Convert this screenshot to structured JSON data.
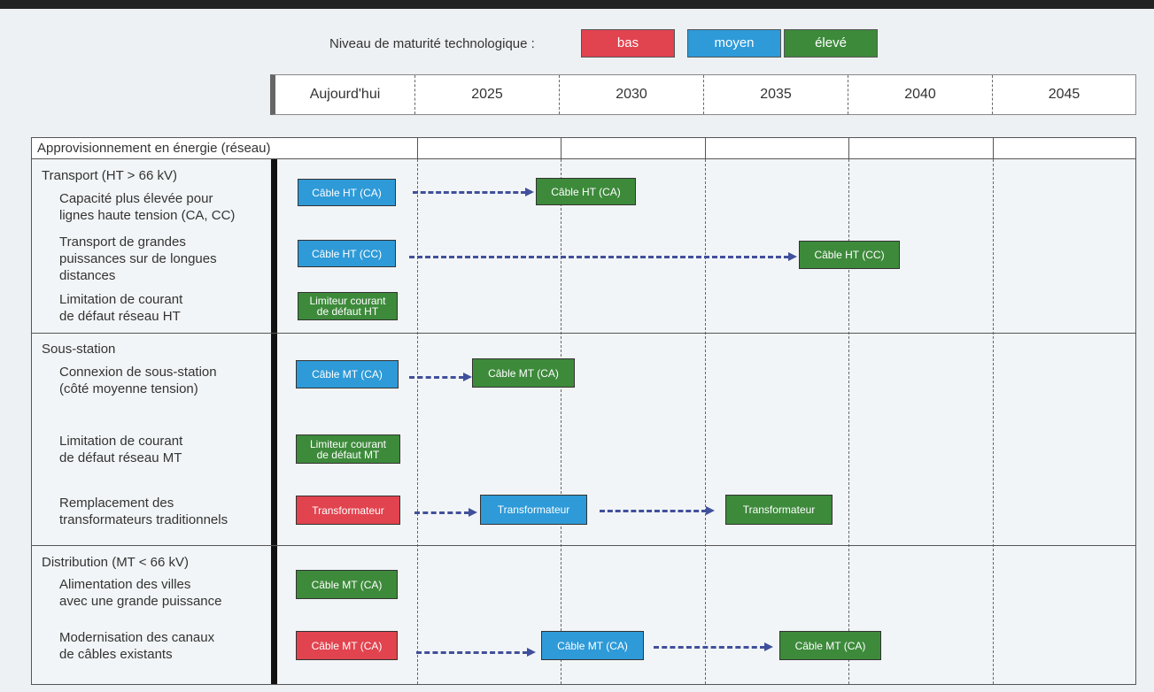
{
  "colors": {
    "low": "#e1434f",
    "medium": "#2e9ad8",
    "high": "#3d8a3b",
    "arrow": "#41509b"
  },
  "legend": {
    "title": "Niveau de maturité technologique :",
    "levels": [
      "bas",
      "moyen",
      "élevé"
    ]
  },
  "timeline": [
    "Aujourd'hui",
    "2025",
    "2030",
    "2035",
    "2040",
    "2045"
  ],
  "grid_title": "Approvisionnement en énergie (réseau)",
  "sections": [
    {
      "title": "Transport (HT > 66 kV)",
      "rows": [
        {
          "label": "Capacité plus élevée pour\nlignes haute tension (CA, CC)",
          "items": [
            {
              "text": "Câble HT (CA)",
              "level": "medium",
              "period": "Aujourd'hui"
            },
            {
              "text": "Câble HT (CA)",
              "level": "high",
              "period": "2030"
            }
          ]
        },
        {
          "label": "Transport de grandes\npuissances sur de longues\ndistances",
          "items": [
            {
              "text": "Câble HT (CC)",
              "level": "medium",
              "period": "Aujourd'hui"
            },
            {
              "text": "Câble HT (CC)",
              "level": "high",
              "period": "2040"
            }
          ]
        },
        {
          "label": "Limitation de courant\nde défaut réseau HT",
          "items": [
            {
              "text": "Limiteur courant\nde défaut HT",
              "level": "high",
              "period": "Aujourd'hui"
            }
          ]
        }
      ]
    },
    {
      "title": "Sous-station",
      "rows": [
        {
          "label": "Connexion de sous-station\n(côté moyenne tension)",
          "items": [
            {
              "text": "Câble MT (CA)",
              "level": "medium",
              "period": "Aujourd'hui"
            },
            {
              "text": "Câble MT (CA)",
              "level": "high",
              "period": "2025"
            }
          ]
        },
        {
          "label": "Limitation de courant\nde défaut réseau MT",
          "items": [
            {
              "text": "Limiteur courant\nde défaut MT",
              "level": "high",
              "period": "Aujourd'hui"
            }
          ]
        },
        {
          "label": "Remplacement des\ntransformateurs traditionnels",
          "items": [
            {
              "text": "Transformateur",
              "level": "low",
              "period": "Aujourd'hui"
            },
            {
              "text": "Transformateur",
              "level": "medium",
              "period": "2025"
            },
            {
              "text": "Transformateur",
              "level": "high",
              "period": "2035"
            }
          ]
        }
      ]
    },
    {
      "title": "Distribution (MT < 66 kV)",
      "rows": [
        {
          "label": "Alimentation des villes\navec une grande puissance",
          "items": [
            {
              "text": "Câble MT (CA)",
              "level": "high",
              "period": "Aujourd'hui"
            }
          ]
        },
        {
          "label": "Modernisation des canaux\nde câbles existants",
          "items": [
            {
              "text": "Câble MT (CA)",
              "level": "low",
              "period": "Aujourd'hui"
            },
            {
              "text": "Câble MT (CA)",
              "level": "medium",
              "period": "2030"
            },
            {
              "text": "Câble MT (CA)",
              "level": "high",
              "period": "2035"
            }
          ]
        }
      ]
    }
  ]
}
